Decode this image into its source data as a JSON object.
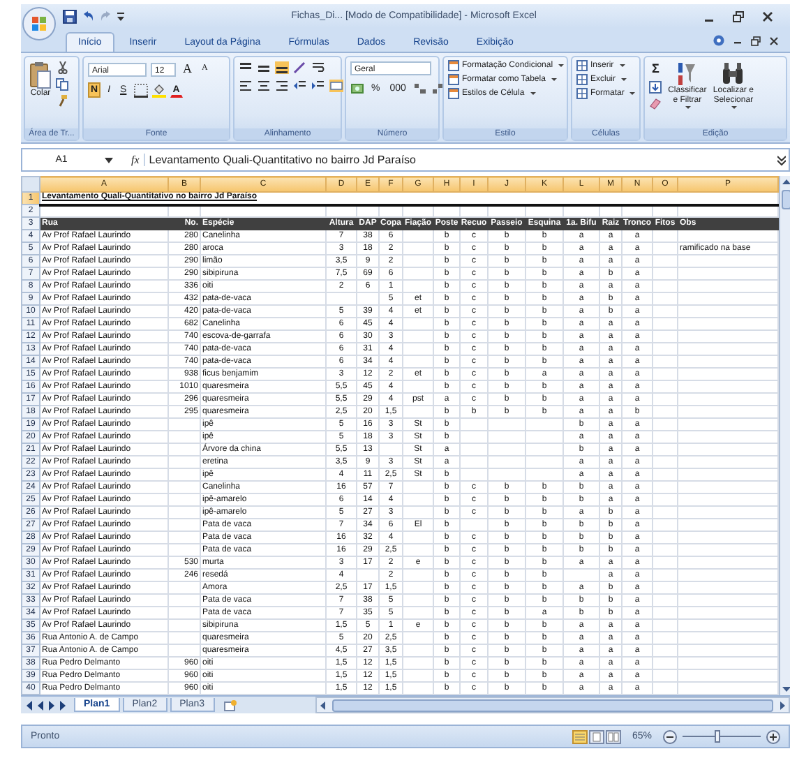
{
  "window": {
    "title": "Fichas_Di... [Modo de Compatibilidade] - Microsoft Excel"
  },
  "tabs": [
    {
      "label": "Início",
      "selected": true
    },
    {
      "label": "Inserir",
      "selected": false
    },
    {
      "label": "Layout da Página",
      "selected": false
    },
    {
      "label": "Fórmulas",
      "selected": false
    },
    {
      "label": "Dados",
      "selected": false
    },
    {
      "label": "Revisão",
      "selected": false
    },
    {
      "label": "Exibição",
      "selected": false
    }
  ],
  "ribbon": {
    "clipboard": {
      "paste": "Colar",
      "label": "Área de Tr..."
    },
    "font": {
      "name": "Arial",
      "size": "12",
      "grow": "A",
      "shrink": "A",
      "bold": "N",
      "italic": "I",
      "underline": "S",
      "color_letter": "A",
      "label": "Fonte"
    },
    "alignment": {
      "label": "Alinhamento"
    },
    "number": {
      "format": "Geral",
      "percent": "%",
      "thousands": "000",
      "label": "Número"
    },
    "styles": {
      "items": [
        "Formatação Condicional",
        "Formatar como Tabela",
        "Estilos de Célula"
      ],
      "label": "Estilo"
    },
    "cells": {
      "items": [
        "Inserir",
        "Excluir",
        "Formatar"
      ],
      "label": "Células"
    },
    "editing": {
      "sum": "Σ",
      "sort": "Classificar e Filtrar",
      "find": "Localizar e Selecionar",
      "label": "Edição"
    }
  },
  "formula_bar": {
    "name_box": "A1",
    "fx": "fx",
    "content": "Levantamento Quali-Quantitativo no bairro Jd Paraíso"
  },
  "sheet": {
    "columns": [
      "A",
      "B",
      "C",
      "D",
      "E",
      "F",
      "G",
      "H",
      "I",
      "J",
      "K",
      "L",
      "M",
      "N",
      "O",
      "P"
    ],
    "title_row": {
      "n": "1",
      "text": "Levantamento Quali-Quantitativo no bairro Jd Paraíso"
    },
    "blank_row": {
      "n": "2"
    },
    "header_row": {
      "n": "3",
      "cells": [
        "Rua",
        "No.",
        "Espécie",
        "Altura",
        "DAP",
        "Copa",
        "Fiação",
        "Poste",
        "Recuo",
        "Passeio",
        "Esquina",
        "1a. Bifu",
        "Raiz",
        "Tronco",
        "Fitos",
        "Obs"
      ]
    },
    "rows": [
      {
        "n": "4",
        "cells": [
          "Av Prof Rafael Laurindo",
          "280",
          "Canelinha",
          "7",
          "38",
          "6",
          "",
          "b",
          "c",
          "b",
          "b",
          "a",
          "a",
          "a",
          "",
          ""
        ]
      },
      {
        "n": "5",
        "cells": [
          "Av Prof Rafael Laurindo",
          "280",
          "aroca",
          "3",
          "18",
          "2",
          "",
          "b",
          "c",
          "b",
          "b",
          "a",
          "a",
          "a",
          "",
          "ramificado na base"
        ]
      },
      {
        "n": "6",
        "cells": [
          "Av Prof Rafael Laurindo",
          "290",
          "limão",
          "3,5",
          "9",
          "2",
          "",
          "b",
          "c",
          "b",
          "b",
          "a",
          "a",
          "a",
          "",
          ""
        ]
      },
      {
        "n": "7",
        "cells": [
          "Av Prof Rafael Laurindo",
          "290",
          "sibipiruna",
          "7,5",
          "69",
          "6",
          "",
          "b",
          "c",
          "b",
          "b",
          "a",
          "b",
          "a",
          "",
          ""
        ]
      },
      {
        "n": "8",
        "cells": [
          "Av Prof Rafael Laurindo",
          "336",
          "oiti",
          "2",
          "6",
          "1",
          "",
          "b",
          "c",
          "b",
          "b",
          "a",
          "a",
          "a",
          "",
          ""
        ]
      },
      {
        "n": "9",
        "cells": [
          "Av Prof Rafael Laurindo",
          "432",
          "pata-de-vaca",
          "",
          "",
          "5",
          "et",
          "b",
          "c",
          "b",
          "b",
          "a",
          "b",
          "a",
          "",
          ""
        ]
      },
      {
        "n": "10",
        "cells": [
          "Av Prof Rafael Laurindo",
          "420",
          "pata-de-vaca",
          "5",
          "39",
          "4",
          "et",
          "b",
          "c",
          "b",
          "b",
          "a",
          "b",
          "a",
          "",
          ""
        ]
      },
      {
        "n": "11",
        "cells": [
          "Av Prof Rafael Laurindo",
          "682",
          "Canelinha",
          "6",
          "45",
          "4",
          "",
          "b",
          "c",
          "b",
          "b",
          "a",
          "a",
          "a",
          "",
          ""
        ]
      },
      {
        "n": "12",
        "cells": [
          "Av Prof Rafael Laurindo",
          "740",
          "escova-de-garrafa",
          "6",
          "30",
          "3",
          "",
          "b",
          "c",
          "b",
          "b",
          "a",
          "a",
          "a",
          "",
          ""
        ]
      },
      {
        "n": "13",
        "cells": [
          "Av Prof Rafael Laurindo",
          "740",
          "pata-de-vaca",
          "6",
          "31",
          "4",
          "",
          "b",
          "c",
          "b",
          "b",
          "a",
          "a",
          "a",
          "",
          ""
        ]
      },
      {
        "n": "14",
        "cells": [
          "Av Prof Rafael Laurindo",
          "740",
          "pata-de-vaca",
          "6",
          "34",
          "4",
          "",
          "b",
          "c",
          "b",
          "b",
          "a",
          "a",
          "a",
          "",
          ""
        ]
      },
      {
        "n": "15",
        "cells": [
          "Av Prof Rafael Laurindo",
          "938",
          "ficus benjamim",
          "3",
          "12",
          "2",
          "et",
          "b",
          "c",
          "b",
          "a",
          "a",
          "a",
          "a",
          "",
          ""
        ]
      },
      {
        "n": "16",
        "cells": [
          "Av Prof Rafael Laurindo",
          "1010",
          "quaresmeira",
          "5,5",
          "45",
          "4",
          "",
          "b",
          "c",
          "b",
          "b",
          "a",
          "a",
          "a",
          "",
          ""
        ]
      },
      {
        "n": "17",
        "cells": [
          "Av Prof Rafael Laurindo",
          "296",
          "quaresmeira",
          "5,5",
          "29",
          "4",
          "pst",
          "a",
          "c",
          "b",
          "b",
          "a",
          "a",
          "a",
          "",
          ""
        ]
      },
      {
        "n": "18",
        "cells": [
          "Av Prof Rafael Laurindo",
          "295",
          "quaresmeira",
          "2,5",
          "20",
          "1,5",
          "",
          "b",
          "b",
          "b",
          "b",
          "a",
          "a",
          "b",
          "",
          ""
        ]
      },
      {
        "n": "19",
        "cells": [
          "Av Prof Rafael Laurindo",
          "",
          "ipê",
          "5",
          "16",
          "3",
          "St",
          "b",
          "",
          "",
          "",
          "b",
          "a",
          "a",
          "",
          ""
        ]
      },
      {
        "n": "20",
        "cells": [
          "Av Prof Rafael Laurindo",
          "",
          "ipê",
          "5",
          "18",
          "3",
          "St",
          "b",
          "",
          "",
          "",
          "a",
          "a",
          "a",
          "",
          ""
        ]
      },
      {
        "n": "21",
        "cells": [
          "Av Prof Rafael Laurindo",
          "",
          "Árvore da china",
          "5,5",
          "13",
          "",
          "St",
          "a",
          "",
          "",
          "",
          "b",
          "a",
          "a",
          "",
          ""
        ]
      },
      {
        "n": "22",
        "cells": [
          "Av Prof Rafael Laurindo",
          "",
          "eretina",
          "3,5",
          "9",
          "3",
          "St",
          "a",
          "",
          "",
          "",
          "a",
          "a",
          "a",
          "",
          ""
        ]
      },
      {
        "n": "23",
        "cells": [
          "Av Prof Rafael Laurindo",
          "",
          "ipê",
          "4",
          "11",
          "2,5",
          "St",
          "b",
          "",
          "",
          "",
          "a",
          "a",
          "a",
          "",
          ""
        ]
      },
      {
        "n": "24",
        "cells": [
          "Av Prof Rafael Laurindo",
          "",
          "Canelinha",
          "16",
          "57",
          "7",
          "",
          "b",
          "c",
          "b",
          "b",
          "b",
          "a",
          "a",
          "",
          ""
        ]
      },
      {
        "n": "25",
        "cells": [
          "Av Prof Rafael Laurindo",
          "",
          "ipê-amarelo",
          "6",
          "14",
          "4",
          "",
          "b",
          "c",
          "b",
          "b",
          "b",
          "a",
          "a",
          "",
          ""
        ]
      },
      {
        "n": "26",
        "cells": [
          "Av Prof Rafael Laurindo",
          "",
          "ipê-amarelo",
          "5",
          "27",
          "3",
          "",
          "b",
          "c",
          "b",
          "b",
          "a",
          "b",
          "a",
          "",
          ""
        ]
      },
      {
        "n": "27",
        "cells": [
          "Av Prof Rafael Laurindo",
          "",
          "Pata de vaca",
          "7",
          "34",
          "6",
          "El",
          "b",
          "",
          "b",
          "b",
          "b",
          "b",
          "a",
          "",
          ""
        ]
      },
      {
        "n": "28",
        "cells": [
          "Av Prof Rafael Laurindo",
          "",
          "Pata de vaca",
          "16",
          "32",
          "4",
          "",
          "b",
          "c",
          "b",
          "b",
          "b",
          "b",
          "a",
          "",
          ""
        ]
      },
      {
        "n": "29",
        "cells": [
          "Av Prof Rafael Laurindo",
          "",
          "Pata de vaca",
          "16",
          "29",
          "2,5",
          "",
          "b",
          "c",
          "b",
          "b",
          "b",
          "b",
          "a",
          "",
          ""
        ]
      },
      {
        "n": "30",
        "cells": [
          "Av Prof Rafael Laurindo",
          "530",
          "murta",
          "3",
          "17",
          "2",
          "e",
          "b",
          "c",
          "b",
          "b",
          "a",
          "a",
          "a",
          "",
          ""
        ]
      },
      {
        "n": "31",
        "cells": [
          "Av Prof Rafael Laurindo",
          "246",
          "resedá",
          "4",
          "",
          "2",
          "",
          "b",
          "c",
          "b",
          "b",
          "",
          "a",
          "a",
          "",
          ""
        ]
      },
      {
        "n": "32",
        "cells": [
          "Av Prof Rafael Laurindo",
          "",
          "Amora",
          "2,5",
          "17",
          "1,5",
          "",
          "b",
          "c",
          "b",
          "b",
          "a",
          "b",
          "a",
          "",
          ""
        ]
      },
      {
        "n": "33",
        "cells": [
          "Av Prof Rafael Laurindo",
          "",
          "Pata de vaca",
          "7",
          "38",
          "5",
          "",
          "b",
          "c",
          "b",
          "b",
          "b",
          "b",
          "a",
          "",
          ""
        ]
      },
      {
        "n": "34",
        "cells": [
          "Av Prof Rafael Laurindo",
          "",
          "Pata de vaca",
          "7",
          "35",
          "5",
          "",
          "b",
          "c",
          "b",
          "a",
          "b",
          "b",
          "a",
          "",
          ""
        ]
      },
      {
        "n": "35",
        "cells": [
          "Av Prof Rafael Laurindo",
          "",
          "sibipiruna",
          "1,5",
          "5",
          "1",
          "e",
          "b",
          "c",
          "b",
          "b",
          "a",
          "a",
          "a",
          "",
          ""
        ]
      },
      {
        "n": "36",
        "cells": [
          "Rua Antonio A. de Campo",
          "",
          "quaresmeira",
          "5",
          "20",
          "2,5",
          "",
          "b",
          "c",
          "b",
          "b",
          "a",
          "a",
          "a",
          "",
          ""
        ]
      },
      {
        "n": "37",
        "cells": [
          "Rua Antonio A. de Campo",
          "",
          "quaresmeira",
          "4,5",
          "27",
          "3,5",
          "",
          "b",
          "c",
          "b",
          "b",
          "a",
          "a",
          "a",
          "",
          ""
        ]
      },
      {
        "n": "38",
        "cells": [
          "Rua Pedro Delmanto",
          "960",
          "oiti",
          "1,5",
          "12",
          "1,5",
          "",
          "b",
          "c",
          "b",
          "b",
          "a",
          "a",
          "a",
          "",
          ""
        ]
      },
      {
        "n": "39",
        "cells": [
          "Rua Pedro Delmanto",
          "960",
          "oiti",
          "1,5",
          "12",
          "1,5",
          "",
          "b",
          "c",
          "b",
          "b",
          "a",
          "a",
          "a",
          "",
          ""
        ]
      },
      {
        "n": "40",
        "cells": [
          "Rua Pedro Delmanto",
          "960",
          "oiti",
          "1,5",
          "12",
          "1,5",
          "",
          "b",
          "c",
          "b",
          "b",
          "a",
          "a",
          "a",
          "",
          ""
        ]
      }
    ]
  },
  "sheet_tabs": [
    {
      "label": "Plan1",
      "selected": true
    },
    {
      "label": "Plan2",
      "selected": false
    },
    {
      "label": "Plan3",
      "selected": false
    }
  ],
  "status_bar": {
    "text": "Pronto",
    "zoom": "65%",
    "zoom_slider": {
      "level": 0.45
    }
  }
}
